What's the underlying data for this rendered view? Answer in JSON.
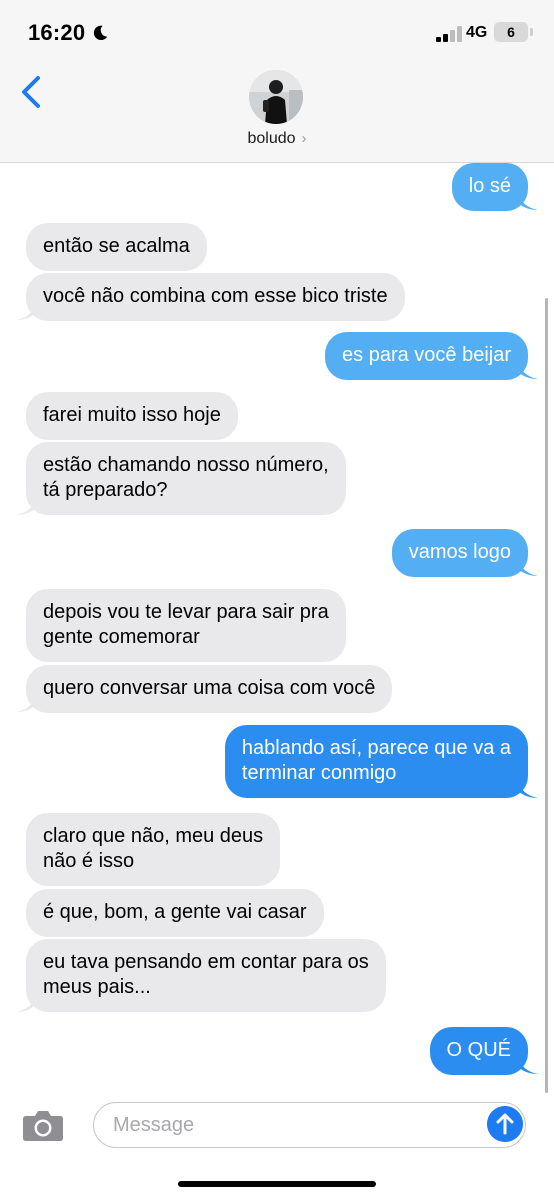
{
  "status_bar": {
    "time": "16:20",
    "network": "4G",
    "battery": "6"
  },
  "header": {
    "contact_name": "boludo",
    "chevron": "›"
  },
  "messages": [
    {
      "sender": "me",
      "text": "lo sé"
    },
    {
      "sender": "them",
      "text": "então se acalma"
    },
    {
      "sender": "them",
      "text": "você não combina com esse bico triste"
    },
    {
      "sender": "me",
      "text": "es para você beijar"
    },
    {
      "sender": "them",
      "text": "farei muito isso hoje"
    },
    {
      "sender": "them",
      "lines": [
        "estão chamando nosso número,",
        "tá preparado?"
      ]
    },
    {
      "sender": "me",
      "text": "vamos logo"
    },
    {
      "sender": "them",
      "lines": [
        "depois vou te levar para sair pra",
        "gente comemorar"
      ]
    },
    {
      "sender": "them",
      "text": "quero conversar uma coisa com você"
    },
    {
      "sender": "me",
      "lines": [
        "hablando así, parece que va a",
        "terminar conmigo"
      ]
    },
    {
      "sender": "them",
      "lines": [
        "claro que não, meu deus",
        "não é isso"
      ]
    },
    {
      "sender": "them",
      "text": "é que, bom, a gente vai casar"
    },
    {
      "sender": "them",
      "lines": [
        "eu tava pensando em contar para os",
        "meus pais..."
      ]
    },
    {
      "sender": "me",
      "text": "O QUÉ"
    }
  ],
  "composer": {
    "placeholder": "Message"
  },
  "icons": [
    "moon-icon",
    "signal-icon",
    "battery-icon",
    "back-chevron-icon",
    "camera-icon",
    "send-arrow-icon"
  ],
  "colors": {
    "incoming_bubble": "#e9e9eb",
    "outgoing_bubble": "#53aef3",
    "outgoing_bubble_deep": "#2b8df0",
    "accent": "#1d7cf2",
    "header_bg": "#f6f6f6"
  }
}
